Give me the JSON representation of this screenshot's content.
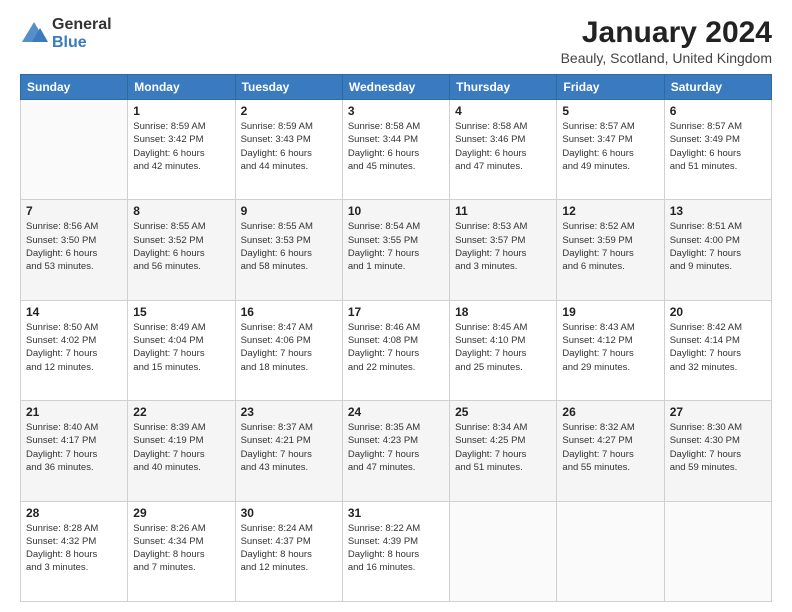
{
  "header": {
    "logo_general": "General",
    "logo_blue": "Blue",
    "month_title": "January 2024",
    "location": "Beauly, Scotland, United Kingdom"
  },
  "days_of_week": [
    "Sunday",
    "Monday",
    "Tuesday",
    "Wednesday",
    "Thursday",
    "Friday",
    "Saturday"
  ],
  "weeks": [
    [
      {
        "day": "",
        "info": ""
      },
      {
        "day": "1",
        "info": "Sunrise: 8:59 AM\nSunset: 3:42 PM\nDaylight: 6 hours\nand 42 minutes."
      },
      {
        "day": "2",
        "info": "Sunrise: 8:59 AM\nSunset: 3:43 PM\nDaylight: 6 hours\nand 44 minutes."
      },
      {
        "day": "3",
        "info": "Sunrise: 8:58 AM\nSunset: 3:44 PM\nDaylight: 6 hours\nand 45 minutes."
      },
      {
        "day": "4",
        "info": "Sunrise: 8:58 AM\nSunset: 3:46 PM\nDaylight: 6 hours\nand 47 minutes."
      },
      {
        "day": "5",
        "info": "Sunrise: 8:57 AM\nSunset: 3:47 PM\nDaylight: 6 hours\nand 49 minutes."
      },
      {
        "day": "6",
        "info": "Sunrise: 8:57 AM\nSunset: 3:49 PM\nDaylight: 6 hours\nand 51 minutes."
      }
    ],
    [
      {
        "day": "7",
        "info": "Sunrise: 8:56 AM\nSunset: 3:50 PM\nDaylight: 6 hours\nand 53 minutes."
      },
      {
        "day": "8",
        "info": "Sunrise: 8:55 AM\nSunset: 3:52 PM\nDaylight: 6 hours\nand 56 minutes."
      },
      {
        "day": "9",
        "info": "Sunrise: 8:55 AM\nSunset: 3:53 PM\nDaylight: 6 hours\nand 58 minutes."
      },
      {
        "day": "10",
        "info": "Sunrise: 8:54 AM\nSunset: 3:55 PM\nDaylight: 7 hours\nand 1 minute."
      },
      {
        "day": "11",
        "info": "Sunrise: 8:53 AM\nSunset: 3:57 PM\nDaylight: 7 hours\nand 3 minutes."
      },
      {
        "day": "12",
        "info": "Sunrise: 8:52 AM\nSunset: 3:59 PM\nDaylight: 7 hours\nand 6 minutes."
      },
      {
        "day": "13",
        "info": "Sunrise: 8:51 AM\nSunset: 4:00 PM\nDaylight: 7 hours\nand 9 minutes."
      }
    ],
    [
      {
        "day": "14",
        "info": "Sunrise: 8:50 AM\nSunset: 4:02 PM\nDaylight: 7 hours\nand 12 minutes."
      },
      {
        "day": "15",
        "info": "Sunrise: 8:49 AM\nSunset: 4:04 PM\nDaylight: 7 hours\nand 15 minutes."
      },
      {
        "day": "16",
        "info": "Sunrise: 8:47 AM\nSunset: 4:06 PM\nDaylight: 7 hours\nand 18 minutes."
      },
      {
        "day": "17",
        "info": "Sunrise: 8:46 AM\nSunset: 4:08 PM\nDaylight: 7 hours\nand 22 minutes."
      },
      {
        "day": "18",
        "info": "Sunrise: 8:45 AM\nSunset: 4:10 PM\nDaylight: 7 hours\nand 25 minutes."
      },
      {
        "day": "19",
        "info": "Sunrise: 8:43 AM\nSunset: 4:12 PM\nDaylight: 7 hours\nand 29 minutes."
      },
      {
        "day": "20",
        "info": "Sunrise: 8:42 AM\nSunset: 4:14 PM\nDaylight: 7 hours\nand 32 minutes."
      }
    ],
    [
      {
        "day": "21",
        "info": "Sunrise: 8:40 AM\nSunset: 4:17 PM\nDaylight: 7 hours\nand 36 minutes."
      },
      {
        "day": "22",
        "info": "Sunrise: 8:39 AM\nSunset: 4:19 PM\nDaylight: 7 hours\nand 40 minutes."
      },
      {
        "day": "23",
        "info": "Sunrise: 8:37 AM\nSunset: 4:21 PM\nDaylight: 7 hours\nand 43 minutes."
      },
      {
        "day": "24",
        "info": "Sunrise: 8:35 AM\nSunset: 4:23 PM\nDaylight: 7 hours\nand 47 minutes."
      },
      {
        "day": "25",
        "info": "Sunrise: 8:34 AM\nSunset: 4:25 PM\nDaylight: 7 hours\nand 51 minutes."
      },
      {
        "day": "26",
        "info": "Sunrise: 8:32 AM\nSunset: 4:27 PM\nDaylight: 7 hours\nand 55 minutes."
      },
      {
        "day": "27",
        "info": "Sunrise: 8:30 AM\nSunset: 4:30 PM\nDaylight: 7 hours\nand 59 minutes."
      }
    ],
    [
      {
        "day": "28",
        "info": "Sunrise: 8:28 AM\nSunset: 4:32 PM\nDaylight: 8 hours\nand 3 minutes."
      },
      {
        "day": "29",
        "info": "Sunrise: 8:26 AM\nSunset: 4:34 PM\nDaylight: 8 hours\nand 7 minutes."
      },
      {
        "day": "30",
        "info": "Sunrise: 8:24 AM\nSunset: 4:37 PM\nDaylight: 8 hours\nand 12 minutes."
      },
      {
        "day": "31",
        "info": "Sunrise: 8:22 AM\nSunset: 4:39 PM\nDaylight: 8 hours\nand 16 minutes."
      },
      {
        "day": "",
        "info": ""
      },
      {
        "day": "",
        "info": ""
      },
      {
        "day": "",
        "info": ""
      }
    ]
  ]
}
